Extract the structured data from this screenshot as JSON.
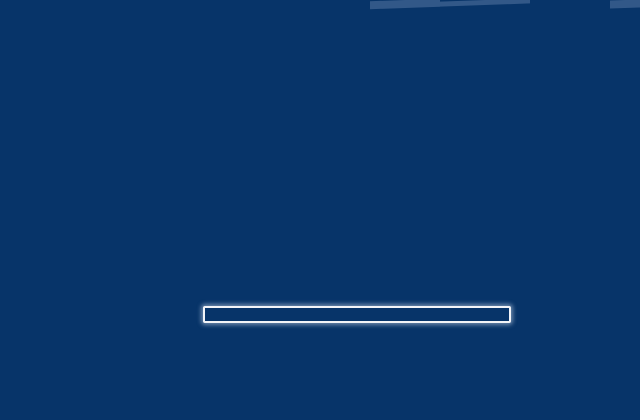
{
  "loading_screen": {
    "progress_percent": 0,
    "colors": {
      "background": "#073469",
      "bar_border": "#f2f4f8"
    }
  }
}
